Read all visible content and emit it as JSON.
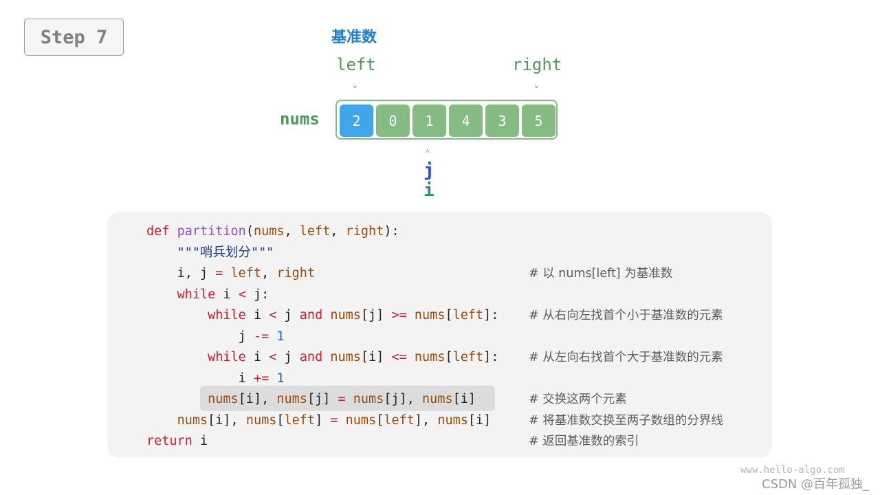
{
  "step": {
    "label": "Step 7"
  },
  "pivot_label": "基准数",
  "pointers": {
    "left": "left",
    "right": "right",
    "j": "j",
    "i": "i",
    "arrow_down": "⌄",
    "arrow_up": "˄"
  },
  "array": {
    "name": "nums",
    "values": [
      "2",
      "0",
      "1",
      "4",
      "3",
      "5"
    ],
    "pivot_index": 0,
    "left_index": 0,
    "right_index": 5,
    "i_index": 2,
    "j_index": 2,
    "colors": {
      "pivot": "#41a5ea",
      "normal": "#86bb84",
      "frame": "#82bb83"
    }
  },
  "code": {
    "highlighted_line": 8,
    "lines": [
      {
        "indent": "",
        "tokens": [
          [
            "kw",
            "def"
          ],
          [
            "",
            " "
          ],
          [
            "fn",
            "partition"
          ],
          [
            "",
            "("
          ],
          [
            "var",
            "nums"
          ],
          [
            "",
            ", "
          ],
          [
            "var",
            "left"
          ],
          [
            "",
            ", "
          ],
          [
            "var",
            "right"
          ],
          [
            "",
            "):"
          ]
        ],
        "comment": ""
      },
      {
        "indent": "    ",
        "tokens": [
          [
            "str",
            "\"\"\"哨兵划分\"\"\""
          ]
        ],
        "comment": ""
      },
      {
        "indent": "    ",
        "tokens": [
          [
            "",
            "i, j "
          ],
          [
            "op",
            "="
          ],
          [
            "",
            ""
          ],
          [
            "var",
            " left"
          ],
          [
            "",
            ", "
          ],
          [
            "var",
            "right"
          ]
        ],
        "comment": "# 以 nums[left] 为基准数"
      },
      {
        "indent": "    ",
        "tokens": [
          [
            "kw",
            "while"
          ],
          [
            "",
            " i "
          ],
          [
            "op",
            "<"
          ],
          [
            "",
            ""
          ],
          [
            "",
            " j:"
          ]
        ],
        "comment": ""
      },
      {
        "indent": "        ",
        "tokens": [
          [
            "kw",
            "while"
          ],
          [
            "",
            " i "
          ],
          [
            "op",
            "<"
          ],
          [
            "",
            " j "
          ],
          [
            "kw",
            "and"
          ],
          [
            "",
            ""
          ],
          [
            "var",
            " nums"
          ],
          [
            "",
            "[j] "
          ],
          [
            "op",
            ">="
          ],
          [
            "var",
            " nums"
          ],
          [
            "",
            "["
          ],
          [
            "var",
            "left"
          ],
          [
            "",
            "]:"
          ]
        ],
        "comment": "# 从右向左找首个小于基准数的元素"
      },
      {
        "indent": "            ",
        "tokens": [
          [
            "",
            "j "
          ],
          [
            "op",
            "-="
          ],
          [
            "num",
            " 1"
          ]
        ],
        "comment": ""
      },
      {
        "indent": "        ",
        "tokens": [
          [
            "kw",
            "while"
          ],
          [
            "",
            " i "
          ],
          [
            "op",
            "<"
          ],
          [
            "",
            " j "
          ],
          [
            "kw",
            "and"
          ],
          [
            "var",
            " nums"
          ],
          [
            "",
            "[i] "
          ],
          [
            "op",
            "<="
          ],
          [
            "var",
            " nums"
          ],
          [
            "",
            "["
          ],
          [
            "var",
            "left"
          ],
          [
            "",
            "]:"
          ]
        ],
        "comment": "# 从左向右找首个大于基准数的元素"
      },
      {
        "indent": "            ",
        "tokens": [
          [
            "",
            "i "
          ],
          [
            "op",
            "+="
          ],
          [
            "num",
            " 1"
          ]
        ],
        "comment": ""
      },
      {
        "indent": "        ",
        "tokens": [
          [
            "var",
            "nums"
          ],
          [
            "",
            "[i], "
          ],
          [
            "var",
            "nums"
          ],
          [
            "",
            "[j] "
          ],
          [
            "op",
            "="
          ],
          [
            "var",
            " nums"
          ],
          [
            "",
            "[j], "
          ],
          [
            "var",
            "nums"
          ],
          [
            "",
            "[i]"
          ]
        ],
        "comment": "# 交换这两个元素"
      },
      {
        "indent": "    ",
        "tokens": [
          [
            "var",
            "nums"
          ],
          [
            "",
            "[i], "
          ],
          [
            "var",
            "nums"
          ],
          [
            "",
            "["
          ],
          [
            "var",
            "left"
          ],
          [
            "",
            "] "
          ],
          [
            "op",
            "="
          ],
          [
            "var",
            " nums"
          ],
          [
            "",
            "["
          ],
          [
            "var",
            "left"
          ],
          [
            "",
            "], "
          ],
          [
            "var",
            "nums"
          ],
          [
            "",
            "[i]"
          ]
        ],
        "comment": "# 将基准数交换至两子数组的分界线"
      },
      {
        "indent": "",
        "tokens": [
          [
            "kw",
            "return"
          ],
          [
            "",
            " i"
          ]
        ],
        "comment": "# 返回基准数的索引"
      }
    ]
  },
  "watermark": {
    "site": "www.hello-algo.com",
    "author": "CSDN @百年孤独_"
  }
}
